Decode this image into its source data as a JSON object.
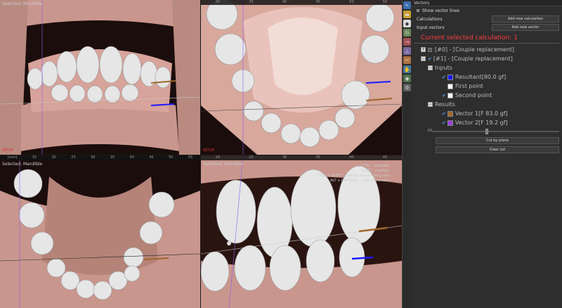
{
  "viewports": {
    "front": {
      "label": "Selected: Mandible",
      "setup": "SETUP"
    },
    "occlusal_upper": {
      "label": "",
      "setup": "SETUP"
    },
    "occlusal_lower": {
      "label": "Selected: Mandible",
      "setup": "",
      "ruler_unit": "[mm]"
    },
    "side_closeup": {
      "label": "Selected: Mandible",
      "setup": "",
      "hints": [
        "CTRL - translate",
        "SHIFT - rotation",
        "CTRL + SHIFT - rotation around long axis",
        "ALT + [MIDDLE] - slow movement"
      ]
    }
  },
  "ruler_ticks": {
    "top_left": [
      "5",
      "10",
      "15",
      "20",
      "25",
      "30"
    ],
    "top_right": [
      "30",
      "35",
      "40",
      "45",
      "50",
      "55"
    ],
    "bottom_left": [
      "15",
      "20",
      "25",
      "30",
      "35",
      "40",
      "45",
      "50",
      "55"
    ],
    "bottom_right": [
      "20",
      "25",
      "30",
      "35",
      "40",
      "45"
    ]
  },
  "toolbar": {
    "icons": [
      "cursor-icon",
      "folder-icon",
      "tooth-icon",
      "rotate-icon",
      "vector-icon",
      "measure-icon",
      "cut-icon",
      "hand-icon",
      "eye-icon",
      "settings-icon"
    ]
  },
  "panel": {
    "title": "Vectors",
    "show_vector_lines": "Show vector lines",
    "calculations_label": "Calculations",
    "add_calculation": "Add new calculation",
    "input_vectors_label": "Input vectors",
    "add_vector": "Add new vector",
    "current_selected": "Current selected calculation: 1",
    "calc0": "[#0] - [Couple replacement]",
    "calc1": "[#1] - [Couple replacement]",
    "inputs": "Inputs",
    "resultant": "Resultant[80.0 gf]",
    "first_point": "First point",
    "second_point": "Second point",
    "results": "Results",
    "vector1": "Vector 1[F 83.0 gf]",
    "vector2": "Vector 2[F 19.2 gf]",
    "slider_label": "-10",
    "slider_value": 0.42,
    "cut_by_plane": "Cut by plane",
    "clear_cut": "Clear cut"
  },
  "colors": {
    "resultant": "#1a1aff",
    "vector1": "#a0672a",
    "vector2": "#9b3fe0",
    "current_selected": "#ff3b3b",
    "gum": "#c9968d",
    "tooth": "#e6e6e6"
  }
}
